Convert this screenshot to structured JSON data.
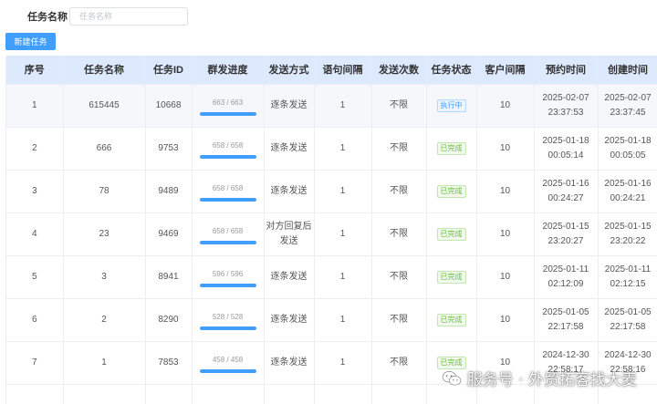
{
  "search": {
    "label": "任务名称",
    "placeholder": "任务名称"
  },
  "toolbar": {
    "new_task_label": "新建任务"
  },
  "table": {
    "headers": [
      "序号",
      "任务名称",
      "任务ID",
      "群发进度",
      "发送方式",
      "语句间隔",
      "发送次数",
      "任务状态",
      "客户间隔",
      "预约时间",
      "创建时间"
    ],
    "rows": [
      {
        "index": "1",
        "name": "615445",
        "id": "10668",
        "progress_text": "663 / 663",
        "progress": 1.0,
        "method": "逐条发送",
        "interval": "1",
        "times": "不限",
        "status": "执行中",
        "status_kind": "running",
        "client_interval": "10",
        "schedule_date": "2025-02-07",
        "schedule_time": "23:37:53",
        "created_date": "2025-02-07",
        "created_time": "23:37:45"
      },
      {
        "index": "2",
        "name": "666",
        "id": "9753",
        "progress_text": "658 / 658",
        "progress": 1.0,
        "method": "逐条发送",
        "interval": "1",
        "times": "不限",
        "status": "已完成",
        "status_kind": "done",
        "client_interval": "10",
        "schedule_date": "2025-01-18",
        "schedule_time": "00:05:14",
        "created_date": "2025-01-18",
        "created_time": "00:05:05"
      },
      {
        "index": "3",
        "name": "78",
        "id": "9489",
        "progress_text": "658 / 658",
        "progress": 1.0,
        "method": "逐条发送",
        "interval": "1",
        "times": "不限",
        "status": "已完成",
        "status_kind": "done",
        "client_interval": "10",
        "schedule_date": "2025-01-16",
        "schedule_time": "00:24:27",
        "created_date": "2025-01-16",
        "created_time": "00:24:21"
      },
      {
        "index": "4",
        "name": "23",
        "id": "9469",
        "progress_text": "658 / 658",
        "progress": 1.0,
        "method": "对方回复后发送",
        "interval": "1",
        "times": "不限",
        "status": "已完成",
        "status_kind": "done",
        "client_interval": "10",
        "schedule_date": "2025-01-15",
        "schedule_time": "23:20:27",
        "created_date": "2025-01-15",
        "created_time": "23:20:22"
      },
      {
        "index": "5",
        "name": "3",
        "id": "8941",
        "progress_text": "596 / 596",
        "progress": 1.0,
        "method": "逐条发送",
        "interval": "1",
        "times": "不限",
        "status": "已完成",
        "status_kind": "done",
        "client_interval": "10",
        "schedule_date": "2025-01-11",
        "schedule_time": "02:12:09",
        "created_date": "2025-01-11",
        "created_time": "02:12:15"
      },
      {
        "index": "6",
        "name": "2",
        "id": "8290",
        "progress_text": "528 / 528",
        "progress": 1.0,
        "method": "逐条发送",
        "interval": "1",
        "times": "不限",
        "status": "已完成",
        "status_kind": "done",
        "client_interval": "10",
        "schedule_date": "2025-01-05",
        "schedule_time": "22:17:58",
        "created_date": "2025-01-05",
        "created_time": "22:17:58"
      },
      {
        "index": "7",
        "name": "1",
        "id": "7853",
        "progress_text": "458 / 458",
        "progress": 1.0,
        "method": "逐条发送",
        "interval": "1",
        "times": "不限",
        "status": "已完成",
        "status_kind": "done",
        "client_interval": "10",
        "schedule_date": "2024-12-30",
        "schedule_time": "22:58:17",
        "created_date": "2024-12-30",
        "created_time": "22:58:16"
      }
    ]
  },
  "watermark": {
    "text": "服务号 · 外贸拓客找大麦",
    "icon": "wechat-icon"
  },
  "colors": {
    "primary": "#409eff",
    "header_bg": "#dde9fd",
    "success": "#67c23a"
  }
}
